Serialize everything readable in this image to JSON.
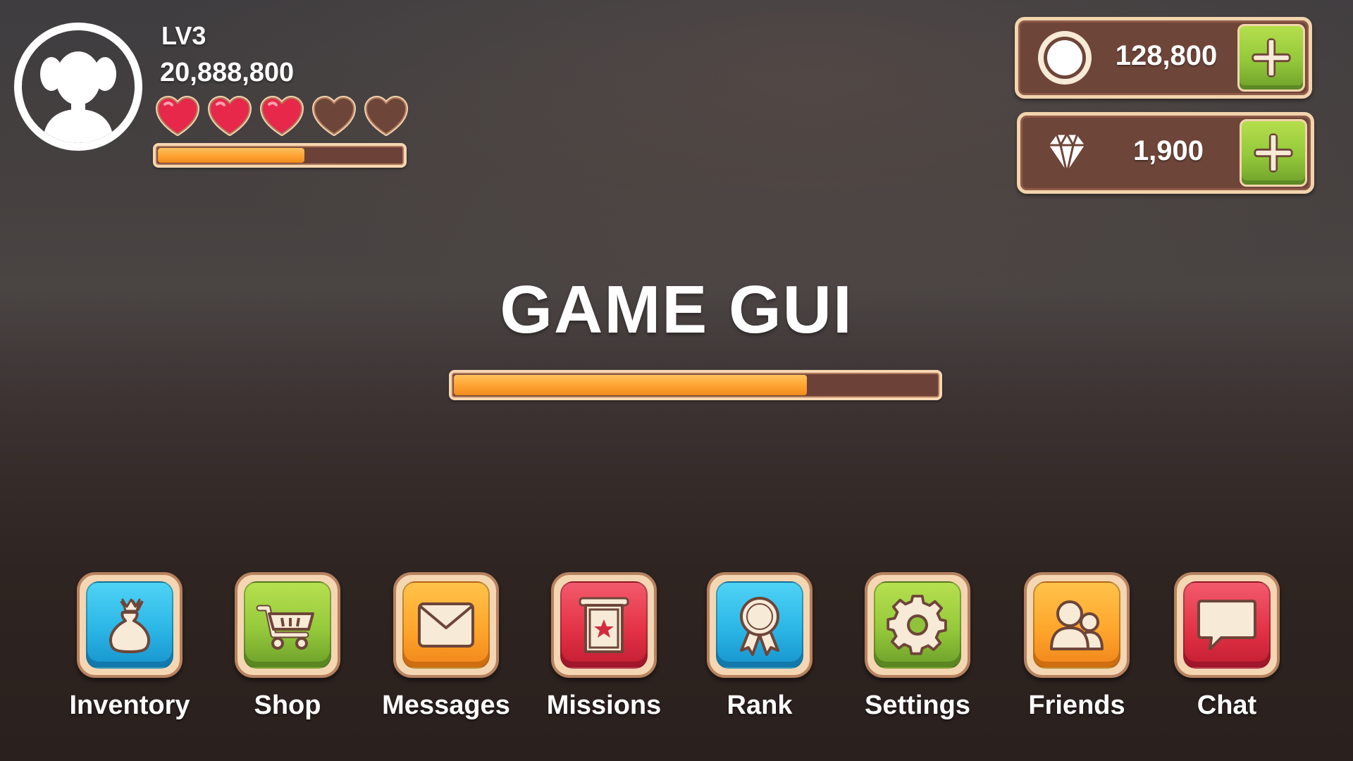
{
  "player": {
    "level": "LV3",
    "score": "20,888,800",
    "hearts_filled": 3,
    "hearts_total": 5,
    "xp_progress": 0.6
  },
  "currency": {
    "coins": "128,800",
    "gems": "1,900"
  },
  "title": "GAME GUI",
  "loading_progress": 0.73,
  "menu": [
    {
      "label": "Inventory",
      "icon": "bag-icon",
      "color": "#2bb6e6"
    },
    {
      "label": "Shop",
      "icon": "cart-icon",
      "color": "#95c93b"
    },
    {
      "label": "Messages",
      "icon": "envelope-icon",
      "color": "#ffa62c"
    },
    {
      "label": "Missions",
      "icon": "mission-banner-icon",
      "color": "#e43347"
    },
    {
      "label": "Rank",
      "icon": "ribbon-medal-icon",
      "color": "#2bb6e6"
    },
    {
      "label": "Settings",
      "icon": "gear-icon",
      "color": "#95c93b"
    },
    {
      "label": "Friends",
      "icon": "friends-icon",
      "color": "#ffa62c"
    },
    {
      "label": "Chat",
      "icon": "speech-bubble-icon",
      "color": "#e43347"
    }
  ],
  "colors": {
    "heart_full": "#e8284a",
    "heart_empty": "#6e4539",
    "panel_brown": "#6e4539",
    "panel_border": "#f2d4ad",
    "progress_orange": "#ffa434"
  }
}
